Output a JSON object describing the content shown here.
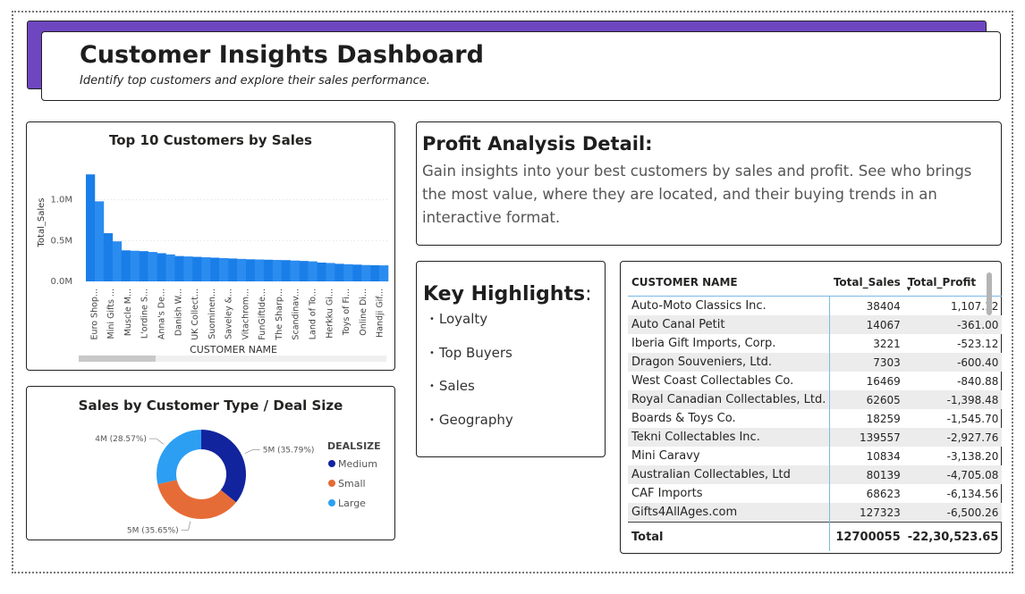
{
  "header": {
    "title": "Customer Insights Dashboard",
    "subtitle": "Identify top customers and explore their sales performance."
  },
  "colors": {
    "accent": "#6e46c0",
    "bar": "#2b8cf0",
    "bar_dark": "#1a7ee8",
    "medium": "#12239e",
    "small": "#e66c37",
    "large": "#2c9ff3"
  },
  "chart_data": [
    {
      "type": "bar",
      "title": "Top 10 Customers by Sales",
      "xlabel": "CUSTOMER NAME",
      "ylabel": "Total_Sales",
      "ylim": [
        0,
        1400000
      ],
      "yticks": [
        "0.0M",
        "0.5M",
        "1.0M"
      ],
      "grid": true,
      "categories": [
        "Euro Shop...",
        "Mini Gifts ...",
        "Muscle M...",
        "L'ordine S...",
        "Anna's De...",
        "Danish W...",
        "UK Collect...",
        "Suominen...",
        "Saveley &...",
        "Vitachrom...",
        "FunGiftIde...",
        "The Sharp...",
        "Scandinav...",
        "Land of To...",
        "Herkku Gi...",
        "Toys of Fi...",
        "Online Di...",
        "Handji Gif..."
      ],
      "values": [
        1310000,
        980000,
        590000,
        490000,
        380000,
        375000,
        370000,
        360000,
        345000,
        330000,
        310000,
        305000,
        300000,
        295000,
        290000,
        285000,
        280000,
        275000,
        270000,
        268000,
        265000,
        262000,
        260000,
        255000,
        250000,
        245000,
        230000,
        225000,
        215000,
        210000,
        205000,
        200000,
        198000,
        196000
      ]
    },
    {
      "type": "pie",
      "title": "Sales by Customer Type / Deal Size",
      "legend_title": "DEALSIZE",
      "legend_position": "right",
      "slices": [
        {
          "name": "Medium",
          "value": 35.79,
          "label": "5M (35.79%)"
        },
        {
          "name": "Small",
          "value": 35.65,
          "label": "5M (35.65%)"
        },
        {
          "name": "Large",
          "value": 28.57,
          "label": "4M (28.57%)"
        }
      ]
    }
  ],
  "profit": {
    "title": "Profit Analysis Detail:",
    "description": "Gain insights into your best customers by sales and profit. See who brings the most value, where they are located, and their buying trends in an interactive format."
  },
  "highlights": {
    "title": "Key Highlights",
    "colon": ":",
    "items": [
      "Loyalty",
      "Top Buyers",
      "Sales",
      "Geography"
    ]
  },
  "table": {
    "columns": [
      "CUSTOMER NAME",
      "Total_Sales",
      "Total_Profit"
    ],
    "sort_indicator": "▾",
    "rows": [
      [
        "Auto-Moto Classics Inc.",
        "38404",
        "1,107.12"
      ],
      [
        "Auto Canal Petit",
        "14067",
        "-361.00"
      ],
      [
        "Iberia Gift Imports, Corp.",
        "3221",
        "-523.12"
      ],
      [
        "Dragon Souveniers, Ltd.",
        "7303",
        "-600.40"
      ],
      [
        "West Coast Collectables Co.",
        "16469",
        "-840.88"
      ],
      [
        "Royal Canadian Collectables, Ltd.",
        "62605",
        "-1,398.48"
      ],
      [
        "Boards & Toys Co.",
        "18259",
        "-1,545.70"
      ],
      [
        "Tekni Collectables Inc.",
        "139557",
        "-2,927.76"
      ],
      [
        "Mini Caravy",
        "10834",
        "-3,138.20"
      ],
      [
        "Australian Collectables, Ltd",
        "80139",
        "-4,705.08"
      ],
      [
        "CAF Imports",
        "68623",
        "-6,134.56"
      ],
      [
        "Gifts4AllAges.com",
        "127323",
        "-6,500.26"
      ]
    ],
    "total": [
      "Total",
      "12700055",
      "-22,30,523.65"
    ]
  }
}
